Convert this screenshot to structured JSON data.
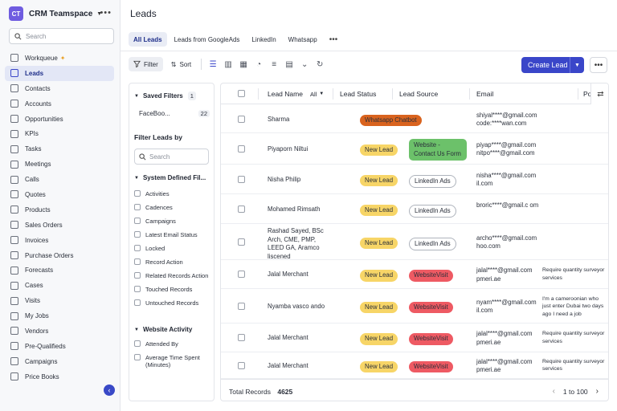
{
  "workspace": {
    "initials": "CT",
    "name": "CRM Teamspace"
  },
  "sidebar": {
    "search_placeholder": "Search",
    "items": [
      {
        "label": "Workqueue",
        "icon": "workqueue-icon"
      },
      {
        "label": "Leads",
        "icon": "leads-icon",
        "active": true
      },
      {
        "label": "Contacts",
        "icon": "contacts-icon"
      },
      {
        "label": "Accounts",
        "icon": "accounts-icon"
      },
      {
        "label": "Opportunities",
        "icon": "opportunities-icon"
      },
      {
        "label": "KPIs",
        "icon": "kpis-icon"
      },
      {
        "label": "Tasks",
        "icon": "tasks-icon"
      },
      {
        "label": "Meetings",
        "icon": "meetings-icon"
      },
      {
        "label": "Calls",
        "icon": "calls-icon"
      },
      {
        "label": "Quotes",
        "icon": "quotes-icon"
      },
      {
        "label": "Products",
        "icon": "products-icon"
      },
      {
        "label": "Sales Orders",
        "icon": "sales-orders-icon"
      },
      {
        "label": "Invoices",
        "icon": "invoices-icon"
      },
      {
        "label": "Purchase Orders",
        "icon": "purchase-orders-icon"
      },
      {
        "label": "Forecasts",
        "icon": "forecasts-icon"
      },
      {
        "label": "Cases",
        "icon": "cases-icon"
      },
      {
        "label": "Visits",
        "icon": "visits-icon"
      },
      {
        "label": "My Jobs",
        "icon": "my-jobs-icon"
      },
      {
        "label": "Vendors",
        "icon": "vendors-icon"
      },
      {
        "label": "Pre-Qualifieds",
        "icon": "pre-qualifieds-icon"
      },
      {
        "label": "Campaigns",
        "icon": "campaigns-icon"
      },
      {
        "label": "Price Books",
        "icon": "price-books-icon"
      }
    ]
  },
  "header": {
    "title": "Leads",
    "tabs": [
      "All Leads",
      "Leads from GoogleAds",
      "LinkedIn",
      "Whatsapp"
    ]
  },
  "toolbar": {
    "filter_label": "Filter",
    "sort_label": "Sort",
    "create_label": "Create Lead"
  },
  "filters": {
    "saved_title": "Saved Filters",
    "saved_count": "1",
    "saved_items": [
      {
        "label": "FaceBoo...",
        "count": "22"
      }
    ],
    "filter_by_title": "Filter Leads by",
    "search_placeholder": "Search",
    "system_title": "System Defined Fil...",
    "system_items": [
      "Activities",
      "Cadences",
      "Campaigns",
      "Latest Email Status",
      "Locked",
      "Record Action",
      "Related Records Action",
      "Touched Records",
      "Untouched Records"
    ],
    "website_title": "Website Activity",
    "website_items": [
      "Attended By",
      "Average Time Spent (Minutes)"
    ]
  },
  "table": {
    "columns": {
      "name": "Lead Name",
      "name_filter": "All",
      "status": "Lead Status",
      "source": "Lead Source",
      "email": "Email",
      "extra": "Po"
    },
    "rows": [
      {
        "name": "Sharma",
        "status": "Whatsapp Chatbot",
        "status_type": "wa",
        "source": "",
        "source_type": "",
        "email": "shiyal****@gmail.com code:****wan.com",
        "note": ""
      },
      {
        "name": "Piyaporn Niltui",
        "status": "New Lead",
        "status_type": "new",
        "source": "Website - Contact Us Form",
        "source_type": "green",
        "email": "piyap****@gmail.com nitpo****@gmail.com",
        "note": ""
      },
      {
        "name": "Nisha Philip",
        "status": "New Lead",
        "status_type": "new",
        "source": "LinkedIn Ads",
        "source_type": "li",
        "email": "nisha****@gmail.com il.com",
        "note": ""
      },
      {
        "name": "Mohamed Rimsath",
        "status": "New Lead",
        "status_type": "new",
        "source": "LinkedIn Ads",
        "source_type": "li",
        "email": "broric****@gmail.c om",
        "note": ""
      },
      {
        "name": "Rashad Sayed, BSc Arch, CME, PMP, LEED GA, Aramco liscened",
        "status": "New Lead",
        "status_type": "new",
        "source": "LinkedIn Ads",
        "source_type": "li",
        "email": "archo****@gmail.com hoo.com",
        "note": ""
      },
      {
        "name": "Jalal Merchant",
        "status": "New Lead",
        "status_type": "new",
        "source": "WebsiteVisit",
        "source_type": "wv",
        "email": "jalal****@gmail.com pmeri.ae",
        "note": "Require quantity surveyor services"
      },
      {
        "name": "Nyamba vasco ando",
        "status": "New Lead",
        "status_type": "new",
        "source": "WebsiteVisit",
        "source_type": "wv",
        "email": "nyam****@gmail.com il.com",
        "note": "I'm a cameroonian who just enter Dubai two days ago I need a job"
      },
      {
        "name": "Jalal Merchant",
        "status": "New Lead",
        "status_type": "new",
        "source": "WebsiteVisit",
        "source_type": "wv",
        "email": "jalal****@gmail.com pmeri.ae",
        "note": "Require quantity surveyor services"
      },
      {
        "name": "Jalal Merchant",
        "status": "New Lead",
        "status_type": "new",
        "source": "WebsiteVisit",
        "source_type": "wv",
        "email": "jalal****@gmail.com pmeri.ae",
        "note": "Require quantity surveyor services"
      }
    ],
    "footer": {
      "total_label": "Total Records",
      "total_value": "4625",
      "page_range": "1 to 100"
    }
  }
}
